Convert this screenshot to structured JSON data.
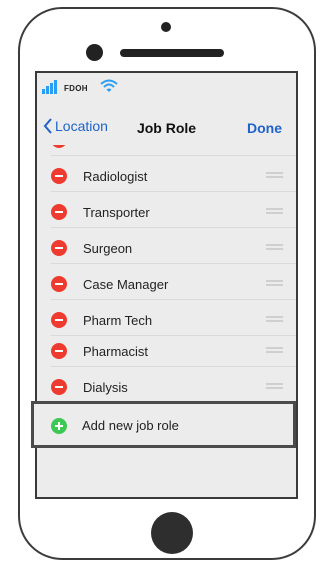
{
  "status_bar": {
    "carrier": "FDOH",
    "signal_icon": "cellular-signal-icon",
    "wifi_icon": "wifi-icon",
    "accent": "#2a9df4"
  },
  "nav": {
    "back_label": "Location",
    "title": "Job Role",
    "done_label": "Done",
    "accent": "#1e63c9"
  },
  "roles": [
    {
      "label": ""
    },
    {
      "label": "Radiologist"
    },
    {
      "label": "Transporter"
    },
    {
      "label": "Surgeon"
    },
    {
      "label": "Case Manager"
    },
    {
      "label": "Pharm Tech"
    },
    {
      "label": "Pharmacist"
    },
    {
      "label": "Dialysis"
    }
  ],
  "add_row": {
    "label": "Add new job role",
    "icon": "add-circle-icon",
    "color": "#3cc854"
  },
  "delete_color": "#ee3b2f"
}
